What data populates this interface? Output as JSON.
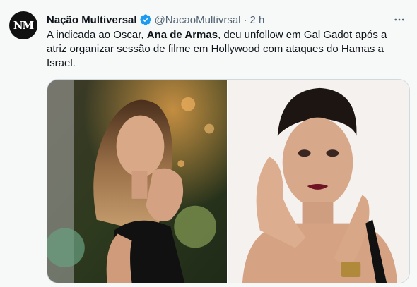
{
  "author": {
    "avatar_text": "NM",
    "name": "Nação Multiversal",
    "handle": "@NacaoMultivrsal",
    "separator": "·",
    "time": "2 h",
    "verified_icon": "verified-badge-icon"
  },
  "tweet": {
    "text_before": "A indicada ao Oscar, ",
    "text_bold": "Ana de Armas",
    "text_after": ", deu unfollow em Gal Gadot após a atriz organizar sessão de filme em Hollywood com ataques do Hamas a Israel."
  },
  "menu": {
    "more_icon": "more-options-icon",
    "more_label": "···"
  },
  "media": {
    "images": [
      "photo-woman-blonde-hair-garden",
      "photo-woman-dark-hair-red-lips"
    ]
  },
  "colors": {
    "accent": "#1d9bf0",
    "secondary_text": "#536471",
    "background": "#f7f9f9"
  }
}
